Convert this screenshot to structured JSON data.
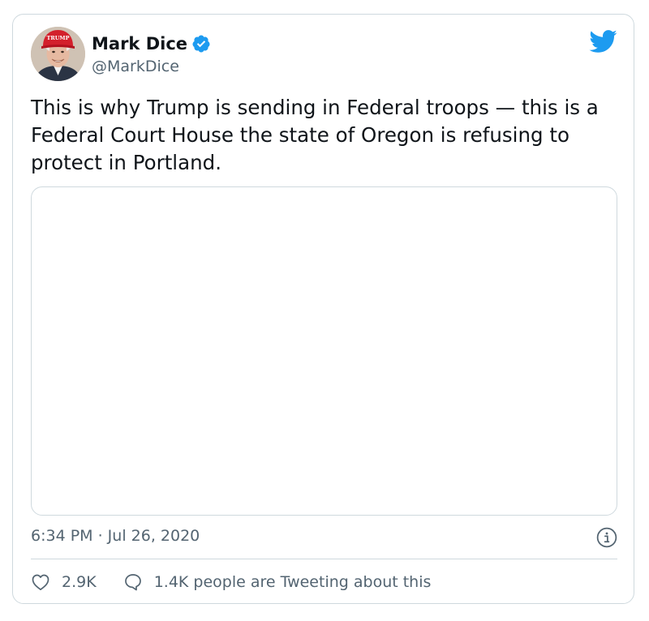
{
  "tweet": {
    "author": {
      "display_name": "Mark Dice",
      "handle": "@MarkDice",
      "verified": true,
      "avatar_hat_text": "TRUMP"
    },
    "text": "This is why Trump is sending in Federal troops — this is a Federal Court House the state of Oregon is refusing to protect in Portland.",
    "timestamp": "6:34 PM · Jul 26, 2020",
    "likes": "2.9K",
    "conversation": "1.4K people are Tweeting about this"
  },
  "icons": {
    "brand": "twitter-bird-icon",
    "verified": "verified-badge-icon",
    "info": "info-icon",
    "like": "heart-icon",
    "reply": "speech-bubble-icon"
  },
  "colors": {
    "brand_blue": "#1d9bf0",
    "text_primary": "#0f1419",
    "text_secondary": "#536471",
    "border": "#cfd9de"
  }
}
